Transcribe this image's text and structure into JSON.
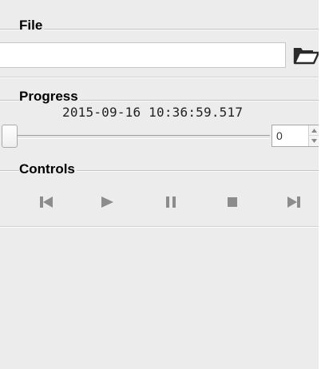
{
  "file_group": {
    "title": "File",
    "path_value": "",
    "path_placeholder": "",
    "browse_icon": "folder-open-icon"
  },
  "progress_group": {
    "title": "Progress",
    "timestamp": "2015-09-16 10:36:59.517",
    "slider_position": 0,
    "spin_value": "0"
  },
  "controls_group": {
    "title": "Controls",
    "buttons": [
      {
        "icon": "skip-back-icon"
      },
      {
        "icon": "play-icon"
      },
      {
        "icon": "pause-icon"
      },
      {
        "icon": "stop-icon"
      },
      {
        "icon": "skip-forward-icon"
      }
    ]
  },
  "colors": {
    "panel_background": "#ececec",
    "control_icon_disabled": "#8c8c8c",
    "input_background": "#ffffff"
  }
}
